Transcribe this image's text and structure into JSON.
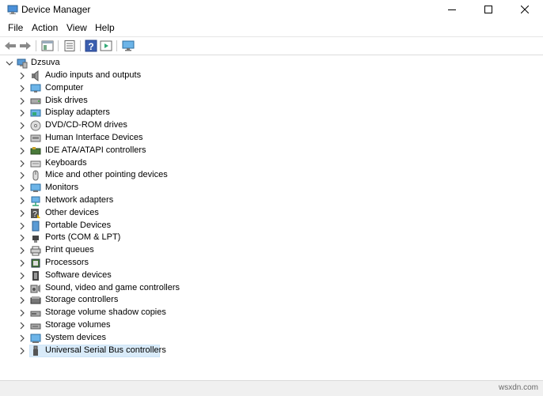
{
  "window": {
    "title": "Device Manager",
    "icon": "device-manager-icon",
    "controls": {
      "minimize_icon": "minimize-icon",
      "maximize_icon": "maximize-icon",
      "close_icon": "close-icon"
    }
  },
  "menu": {
    "items": [
      "File",
      "Action",
      "View",
      "Help"
    ]
  },
  "toolbar": {
    "buttons": [
      "back-icon",
      "forward-icon",
      "show-hide-console-tree-icon",
      "properties-icon",
      "help-icon",
      "run-icon",
      "monitor-icon"
    ]
  },
  "tree": {
    "root": {
      "label": "Dzsuva",
      "icon": "computer-tree-icon"
    },
    "items": [
      {
        "label": "Audio inputs and outputs",
        "icon": "speaker-icon"
      },
      {
        "label": "Computer",
        "icon": "computer-icon"
      },
      {
        "label": "Disk drives",
        "icon": "disk-drive-icon"
      },
      {
        "label": "Display adapters",
        "icon": "display-adapter-icon"
      },
      {
        "label": "DVD/CD-ROM drives",
        "icon": "dvd-icon"
      },
      {
        "label": "Human Interface Devices",
        "icon": "hid-icon"
      },
      {
        "label": "IDE ATA/ATAPI controllers",
        "icon": "ide-controller-icon"
      },
      {
        "label": "Keyboards",
        "icon": "keyboard-icon"
      },
      {
        "label": "Mice and other pointing devices",
        "icon": "mouse-icon"
      },
      {
        "label": "Monitors",
        "icon": "monitor-icon"
      },
      {
        "label": "Network adapters",
        "icon": "network-adapter-icon"
      },
      {
        "label": "Other devices",
        "icon": "unknown-device-icon"
      },
      {
        "label": "Portable Devices",
        "icon": "portable-device-icon"
      },
      {
        "label": "Ports (COM & LPT)",
        "icon": "port-icon"
      },
      {
        "label": "Print queues",
        "icon": "printer-icon"
      },
      {
        "label": "Processors",
        "icon": "processor-icon"
      },
      {
        "label": "Software devices",
        "icon": "software-device-icon"
      },
      {
        "label": "Sound, video and game controllers",
        "icon": "sound-icon"
      },
      {
        "label": "Storage controllers",
        "icon": "storage-controller-icon"
      },
      {
        "label": "Storage volume shadow copies",
        "icon": "shadow-copy-icon"
      },
      {
        "label": "Storage volumes",
        "icon": "storage-volume-icon"
      },
      {
        "label": "System devices",
        "icon": "system-device-icon"
      },
      {
        "label": "Universal Serial Bus controllers",
        "icon": "usb-icon"
      }
    ],
    "selected": "Universal Serial Bus controllers"
  },
  "status": {
    "watermark": "wsxdn.com"
  },
  "colors": {
    "selection": "#d9ebf9",
    "accent": "#0078d7"
  }
}
